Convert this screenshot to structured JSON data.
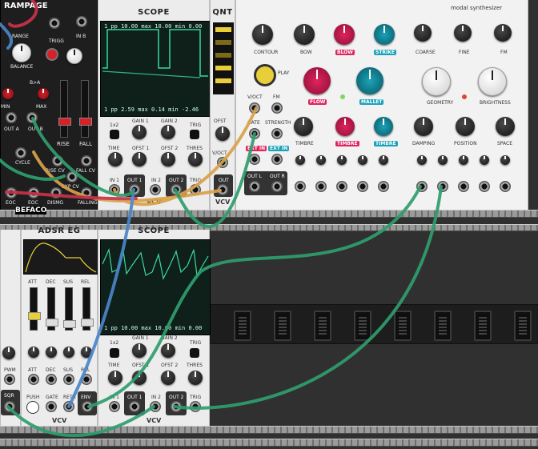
{
  "rampage": {
    "title": "RAMPAGE",
    "labels": [
      "RANGE",
      "TRIGG",
      "IN B",
      "BALANCE",
      "B>A",
      "MIN",
      "MAX",
      "OUT A",
      "OUT B",
      "CYCLE",
      "RISE",
      "FALL",
      "RISE CV",
      "FALL CV",
      "EXP CV",
      "EOC",
      "EOC",
      "DISMG",
      "FALLING"
    ],
    "brand": "BEFACO"
  },
  "scope_top": {
    "title": "SCOPE",
    "stat_top": [
      "1",
      "pp",
      "10.00",
      "max",
      "10.00",
      "min",
      "0.00"
    ],
    "stat_bottom": [
      "1",
      "pp",
      "2.59",
      "max",
      "0.14",
      "min",
      "-2.46"
    ],
    "labels": [
      "1x2",
      "GAIN 1",
      "GAIN 2",
      "TRIG",
      "TIME",
      "OFST 1",
      "OFST 2",
      "THRES",
      "IN 1",
      "OUT 1",
      "IN 2",
      "OUT 2",
      "TRIG"
    ],
    "brand": "VCV"
  },
  "qnt": {
    "title": "QNT",
    "labels": [
      "OFST",
      "V/OCT",
      "OUT"
    ],
    "brand": "VCV"
  },
  "modal": {
    "title": "modal synthesizer",
    "labels": [
      "CONTOUR",
      "BOW",
      "BLOW",
      "STRIKE",
      "COARSE",
      "FINE",
      "FM",
      "PLAY",
      "FLOW",
      "MALLET",
      "GEOMETRY",
      "BRIGHTNESS",
      "V/OCT",
      "FM",
      "GATE",
      "STRENGTH",
      "EXT IN",
      "EXT IN",
      "TIMBRE",
      "TIMBRE",
      "TIMBRE",
      "DAMPING",
      "POSITION",
      "SPACE",
      "OUT L",
      "OUT R"
    ]
  },
  "adsr": {
    "title": "ADSR EG",
    "labels": [
      "ATT",
      "DEC",
      "SUS",
      "REL",
      "ATT",
      "DEC",
      "SUS",
      "REL",
      "PUSH",
      "GATE",
      "RETR",
      "ENV"
    ],
    "brand": "VCV"
  },
  "scope_bottom": {
    "title": "SCOPE",
    "stat_bottom": [
      "1",
      "pp",
      "10.00",
      "max",
      "10.00",
      "min",
      "0.00"
    ],
    "labels": [
      "1x2",
      "GAIN 1",
      "GAIN 2",
      "TRIG",
      "TIME",
      "OFST 1",
      "OFST 2",
      "THRES",
      "IN 1",
      "OUT 1",
      "IN 2",
      "OUT 2",
      "TRIG"
    ],
    "brand": "VCV"
  },
  "left_partial": {
    "labels": [
      "PWM",
      "SQR"
    ]
  },
  "colors": {
    "cable_green": "#2f9e6e",
    "cable_blue": "#4a86c8",
    "cable_orange": "#d9a24a",
    "cable_red": "#c8324a",
    "accent_pink": "#e0245e",
    "accent_teal": "#1aa3b8",
    "scope_trace": "#37d9a0"
  }
}
